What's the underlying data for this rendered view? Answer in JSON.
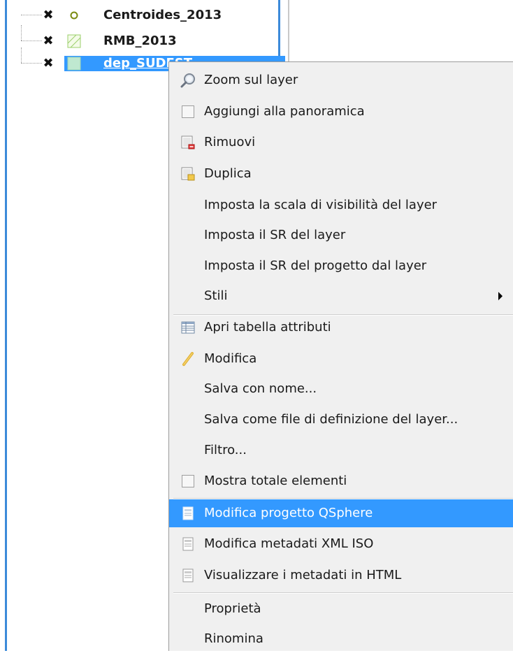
{
  "layer_tree": {
    "items": [
      {
        "label": "Centroides_2013",
        "checked_icon": "x-mark-icon",
        "symbol": "point-circle-icon"
      },
      {
        "label": "RMB_2013",
        "checked_icon": "x-mark-icon",
        "symbol": "hatched-polygon-icon"
      },
      {
        "label": "dep_SUDEST",
        "checked_icon": "x-mark-icon",
        "symbol": "polygon-fill-icon"
      }
    ],
    "check_glyph": "✖"
  },
  "context_menu": {
    "items": [
      {
        "label": "Zoom sul layer",
        "icon": "zoom-icon"
      },
      {
        "label": "Aggiungi alla panoramica",
        "icon": "checkbox-icon"
      },
      {
        "label": "Rimuovi",
        "icon": "remove-layer-icon"
      },
      {
        "label": "Duplica",
        "icon": "duplicate-layer-icon"
      },
      {
        "label": "Imposta la scala di visibilità del layer"
      },
      {
        "label": "Imposta il SR del layer"
      },
      {
        "label": "Imposta il SR del progetto dal layer"
      },
      {
        "label": "Stili",
        "submenu": true
      },
      {
        "label": "Apri tabella attributi",
        "icon": "table-icon"
      },
      {
        "label": "Modifica",
        "icon": "pencil-icon"
      },
      {
        "label": "Salva con nome..."
      },
      {
        "label": "Salva come file di definizione del layer..."
      },
      {
        "label": "Filtro..."
      },
      {
        "label": "Mostra totale elementi",
        "icon": "checkbox-icon"
      },
      {
        "label": "Modifica progetto QSphere",
        "icon": "document-icon",
        "highlighted": true
      },
      {
        "label": "Modifica metadati XML ISO",
        "icon": "document-icon"
      },
      {
        "label": "Visualizzare i metadati in HTML",
        "icon": "document-icon"
      },
      {
        "label": "Proprietà"
      },
      {
        "label": "Rinomina"
      }
    ]
  },
  "colors": {
    "selection": "#3399ff",
    "menu_background": "#f0f0f0",
    "panel_border": "#3c8ad9"
  }
}
